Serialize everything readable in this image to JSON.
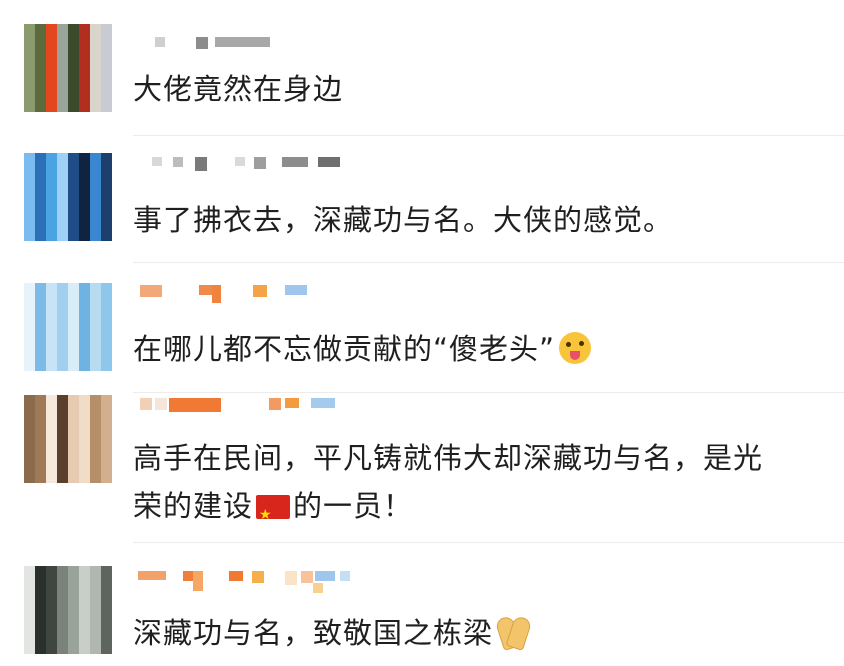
{
  "comments": [
    {
      "text": "大佬竟然在身边",
      "avatar_colors": [
        "#8a9b6e",
        "#5d6a3e",
        "#d9d4cc",
        "#c8ccd2",
        "#3c4a2c",
        "#b22e1f",
        "#e3471f",
        "#9aa59a"
      ]
    },
    {
      "text": "事了拂衣去，深藏功与名。大侠的感觉。",
      "avatar_colors": [
        "#2b6fb6",
        "#4aa3e3",
        "#1c3f6e",
        "#7bbcf0",
        "#0f2440",
        "#3a86d1",
        "#9fd0f5",
        "#214d86"
      ]
    },
    {
      "text": "在哪儿都不忘做贡献的“傻老头”",
      "avatar_colors": [
        "#b7dcf2",
        "#8fc6eb",
        "#d8edf8",
        "#6fb3e2",
        "#c6e4f5",
        "#a2cfee",
        "#e6f3fa",
        "#7dbbe6"
      ]
    },
    {
      "text_line1": "高手在民间，平凡铸就伟大却深藏功与名，是光",
      "text_line2_before": "荣的建设",
      "text_line2_after": "的一员！",
      "avatar_colors": [
        "#d2b08f",
        "#8c6a4c",
        "#f0ddc8",
        "#b68e68",
        "#5a3f2c",
        "#e7cbb0",
        "#a07a58",
        "#f6e9db"
      ]
    },
    {
      "text": "深藏功与名，致敬国之栋梁",
      "avatar_colors": [
        "#9aa39a",
        "#c9cec9",
        "#3e463f",
        "#7a837b",
        "#e2e5e2",
        "#2a302b",
        "#b0b7b0",
        "#5d655e"
      ]
    }
  ],
  "icons": {
    "emoji": "winking-tongue-face-icon",
    "flag": "china-flag-icon",
    "hands": "praying-hands-icon"
  }
}
